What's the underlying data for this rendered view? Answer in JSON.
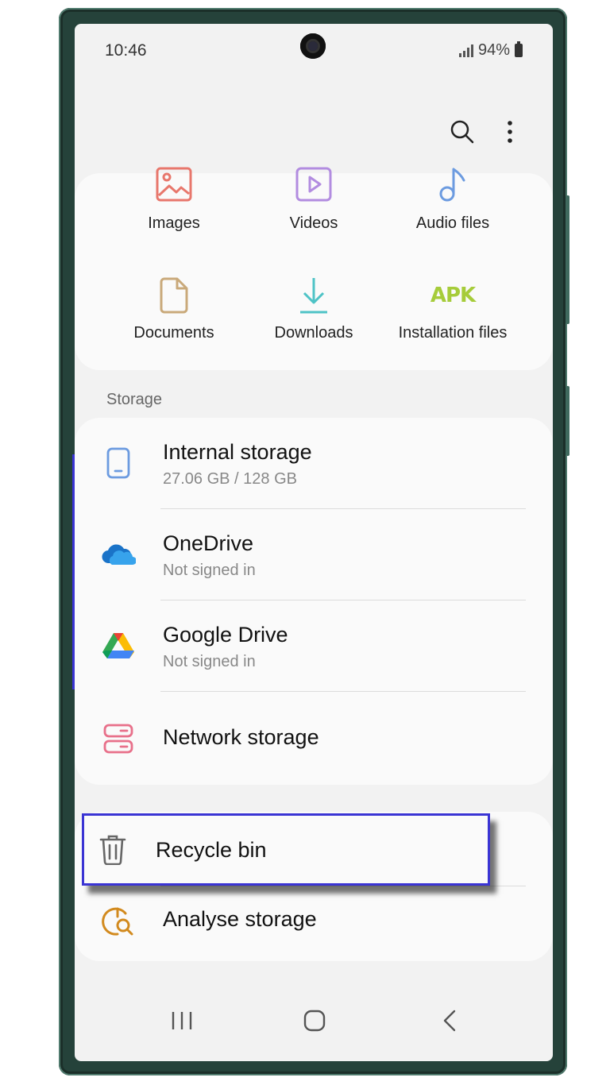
{
  "status_bar": {
    "time": "10:46",
    "battery": "94%"
  },
  "categories": [
    {
      "label": "Images",
      "icon": "image-icon",
      "color": "#e8776c"
    },
    {
      "label": "Videos",
      "icon": "video-icon",
      "color": "#b28ce0"
    },
    {
      "label": "Audio files",
      "icon": "music-note-icon",
      "color": "#6c9be0"
    },
    {
      "label": "Documents",
      "icon": "document-icon",
      "color": "#c9a97a"
    },
    {
      "label": "Downloads",
      "icon": "download-icon",
      "color": "#4ec3c6"
    },
    {
      "label": "Installation files",
      "icon": "apk-icon",
      "icon_text": "APK",
      "color": "#a6cc3a"
    }
  ],
  "storage": {
    "section_label": "Storage",
    "items": [
      {
        "title": "Internal storage",
        "subtitle": "27.06 GB / 128 GB",
        "icon": "phone-icon"
      },
      {
        "title": "OneDrive",
        "subtitle": "Not signed in",
        "icon": "onedrive-icon"
      },
      {
        "title": "Google Drive",
        "subtitle": "Not signed in",
        "icon": "google-drive-icon"
      },
      {
        "title": "Network storage",
        "icon": "network-storage-icon"
      }
    ]
  },
  "tools": {
    "recycle_bin": "Recycle bin",
    "analyse_storage": "Analyse storage"
  },
  "colors": {
    "highlight": "#3a34d4",
    "background": "#f2f2f2",
    "card": "#fafafa"
  }
}
